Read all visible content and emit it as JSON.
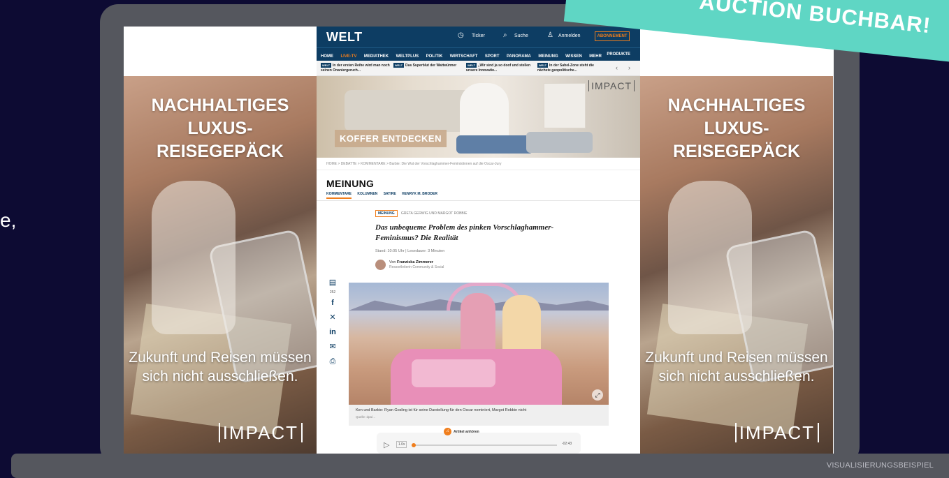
{
  "banner_text": "AUCTION BUCHBAR!",
  "left_fragment": "e,",
  "footer_label": "VISUALISIERUNGSBEISPIEL",
  "side_ad": {
    "headline": "NACHHALTIGES LUXUS- REISEGEPÄCK",
    "sub": "Zukunft und Reisen müssen sich nicht ausschließen.",
    "logo": "IMPACT"
  },
  "header": {
    "logo": "WELT",
    "ticker_label": "Ticker",
    "search_label": "Suche",
    "login_label": "Anmelden",
    "abo_label": "ABONNEMENT"
  },
  "nav": {
    "items": [
      "HOME",
      "LIVE-TV",
      "MEDIATHEK",
      "WELTPLUS",
      "POLITIK",
      "WIRTSCHAFT",
      "SPORT",
      "PANORAMA",
      "MEINUNG",
      "WISSEN",
      "MEHR"
    ],
    "products": "PRODUKTE"
  },
  "ticker": [
    {
      "tag": "WELT",
      "text": "In der ersten Reihe wird man noch seinen Onaniergeruch..."
    },
    {
      "tag": "WELT",
      "text": "Das Superblut der Wattwürmer"
    },
    {
      "tag": "WELT",
      "text": "„Wir sind ja so doof und stellen unsere Innovatio..."
    },
    {
      "tag": "WELT",
      "text": "In der Sahel-Zone steht die nächste geopolitische..."
    }
  ],
  "hero": {
    "button": "KOFFER ENTDECKEN",
    "logo": "IMPACT"
  },
  "breadcrumb": "HOME > DEBATTE > KOMMENTARE > Barbie: Die Wut der Vorschlaghammer-Feministinnen auf die Oscar-Jury",
  "section": {
    "title": "MEINUNG",
    "tabs": [
      "KOMMENTARE",
      "KOLUMNEN",
      "SATIRE",
      "HENRYK M. BRODER"
    ]
  },
  "article": {
    "badge": "MEINUNG",
    "topic": "GRETA GERWIG UND MARGOT ROBBIE",
    "headline": "Das unbequeme Problem des pinken Vorschlaghammer-Feminismus? Die Realität",
    "meta": "Stand: 10:05 Uhr | Lesedauer: 3 Minuten",
    "author_prefix": "Von",
    "author": "Franziska Zimmerer",
    "author_role": "Ressortleiterin Community & Social",
    "comment_count": "252",
    "caption": "Ken und Barbie: Ryan Gosling ist für seine Darstellung für den Oscar nominiert, Margot Robbie nicht",
    "caption_source": "Quelle: dpa/..."
  },
  "audio": {
    "label": "Artikel anhören",
    "speed": "1.0x",
    "duration": "-02:43",
    "progress": 0
  }
}
